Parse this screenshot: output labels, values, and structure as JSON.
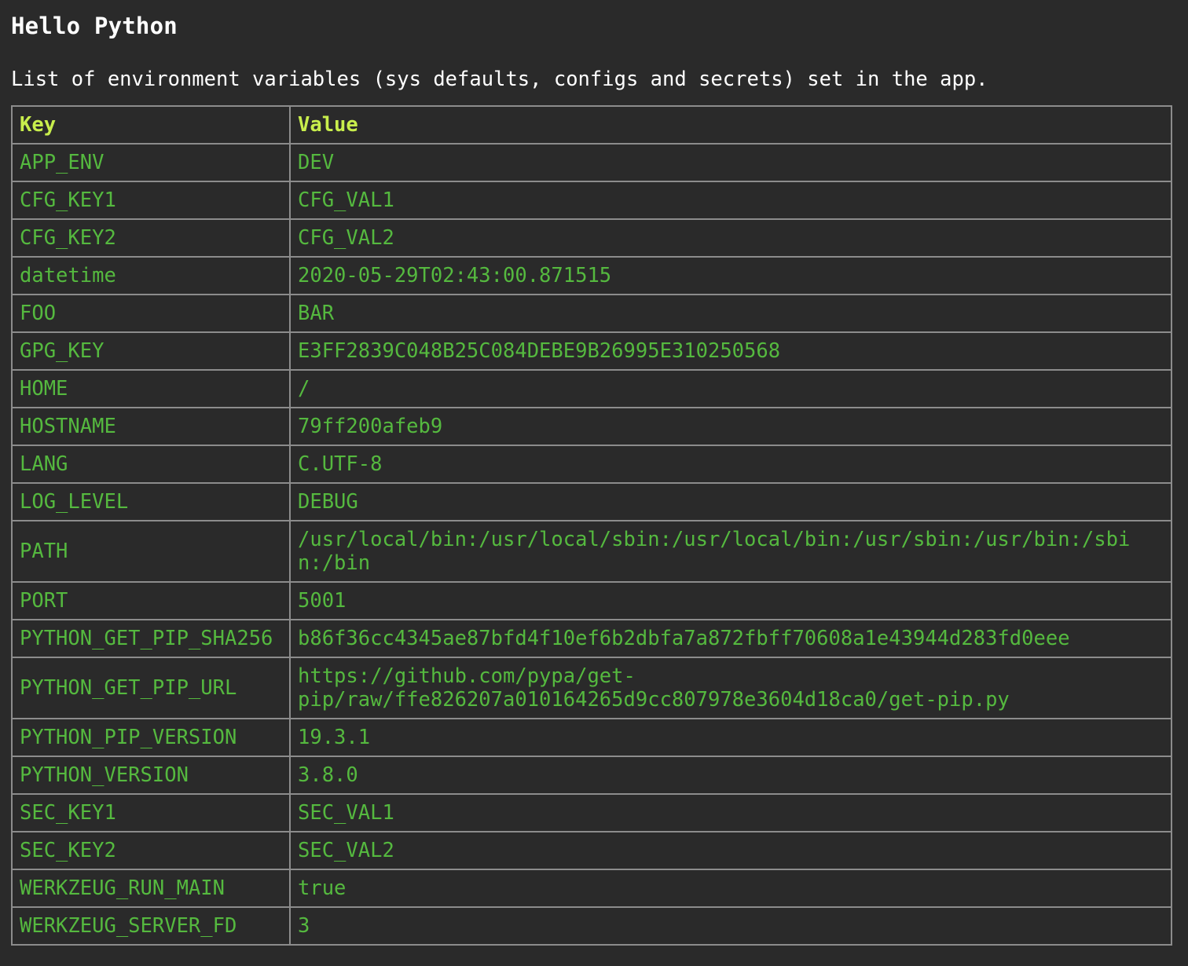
{
  "page": {
    "title": "Hello Python",
    "subtitle": "List of environment variables (sys defaults, configs and secrets) set in the app."
  },
  "table": {
    "headers": {
      "key": "Key",
      "value": "Value"
    },
    "rows": [
      {
        "key": "APP_ENV",
        "value": "DEV"
      },
      {
        "key": "CFG_KEY1",
        "value": "CFG_VAL1"
      },
      {
        "key": "CFG_KEY2",
        "value": "CFG_VAL2"
      },
      {
        "key": "datetime",
        "value": "2020-05-29T02:43:00.871515"
      },
      {
        "key": "FOO",
        "value": "BAR"
      },
      {
        "key": "GPG_KEY",
        "value": "E3FF2839C048B25C084DEBE9B26995E310250568"
      },
      {
        "key": "HOME",
        "value": "/"
      },
      {
        "key": "HOSTNAME",
        "value": "79ff200afeb9"
      },
      {
        "key": "LANG",
        "value": "C.UTF-8"
      },
      {
        "key": "LOG_LEVEL",
        "value": "DEBUG"
      },
      {
        "key": "PATH",
        "value": "/usr/local/bin:/usr/local/sbin:/usr/local/bin:/usr/sbin:/usr/bin:/sbin:/bin"
      },
      {
        "key": "PORT",
        "value": "5001"
      },
      {
        "key": "PYTHON_GET_PIP_SHA256",
        "value": "b86f36cc4345ae87bfd4f10ef6b2dbfa7a872fbff70608a1e43944d283fd0eee"
      },
      {
        "key": "PYTHON_GET_PIP_URL",
        "value": "https://github.com/pypa/get-pip/raw/ffe826207a010164265d9cc807978e3604d18ca0/get-pip.py"
      },
      {
        "key": "PYTHON_PIP_VERSION",
        "value": "19.3.1"
      },
      {
        "key": "PYTHON_VERSION",
        "value": "3.8.0"
      },
      {
        "key": "SEC_KEY1",
        "value": "SEC_VAL1"
      },
      {
        "key": "SEC_KEY2",
        "value": "SEC_VAL2"
      },
      {
        "key": "WERKZEUG_RUN_MAIN",
        "value": "true"
      },
      {
        "key": "WERKZEUG_SERVER_FD",
        "value": "3"
      }
    ]
  },
  "colors": {
    "background": "#2a2a2a",
    "header_text": "#c8ee4c",
    "cell_text": "#55b93f",
    "border": "#8c8c8c"
  }
}
